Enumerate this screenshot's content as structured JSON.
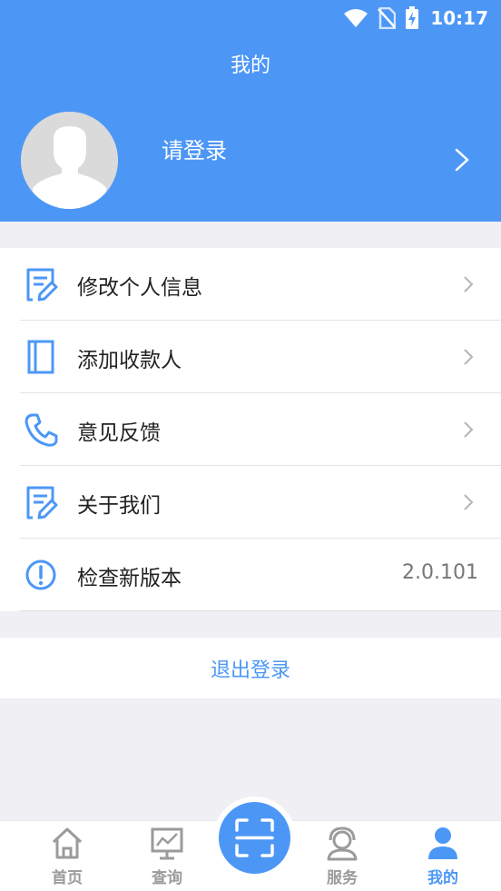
{
  "status_bar": {
    "time": "10:17",
    "icons": [
      "wifi-icon",
      "no-sim-icon",
      "battery-charging-icon"
    ]
  },
  "header": {
    "title": "我的",
    "login_prompt": "请登录"
  },
  "menu": {
    "items": [
      {
        "label": "修改个人信息",
        "icon": "edit-document-icon"
      },
      {
        "label": "添加收款人",
        "icon": "book-icon"
      },
      {
        "label": "意见反馈",
        "icon": "phone-icon"
      },
      {
        "label": "关于我们",
        "icon": "document-icon"
      },
      {
        "label": "检查新版本",
        "icon": "alert-circle-icon",
        "value": "2.0.101"
      }
    ]
  },
  "logout": {
    "label": "退出登录"
  },
  "tabbar": {
    "tabs": [
      {
        "label": "首页",
        "icon": "home-icon"
      },
      {
        "label": "查询",
        "icon": "chart-monitor-icon"
      },
      {
        "label": "",
        "icon": "scan-icon"
      },
      {
        "label": "服务",
        "icon": "customer-service-icon"
      },
      {
        "label": "我的",
        "icon": "user-icon",
        "active": true
      }
    ]
  },
  "colors": {
    "primary": "#4c97f6",
    "background": "#efeff4",
    "inactive_tab": "#9b9b9b"
  }
}
